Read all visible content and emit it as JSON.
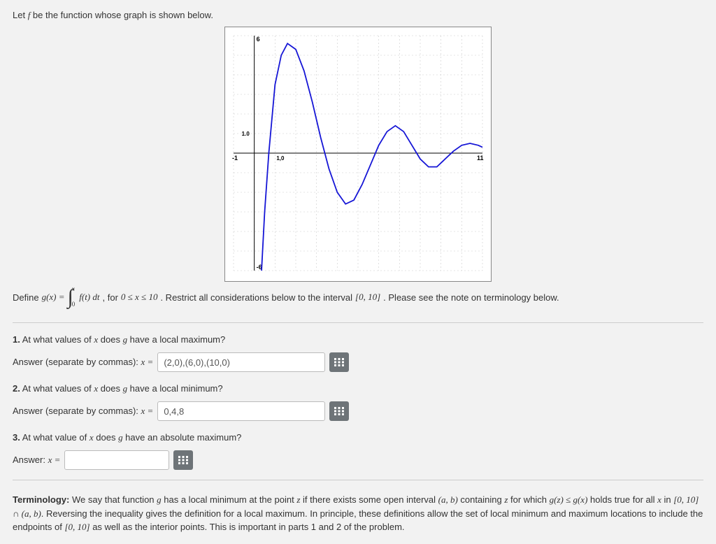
{
  "intro_pre": "Let ",
  "intro_fn": "f",
  "intro_post": " be the function whose graph is shown below.",
  "define": {
    "pre": "Define ",
    "lhs": "g(x) = ",
    "int_lower": "0",
    "int_upper": "x",
    "integrand": "f(t) dt",
    "post1": ", for ",
    "cond": "0 ≤ x ≤ 10",
    "post2": ". Restrict all considerations below to the interval ",
    "interval": "[0, 10]",
    "post3": ". Please see the note on terminology below."
  },
  "q1": {
    "num": "1.",
    "text": " At what values of ",
    "var": "x",
    "text2": " does ",
    "fn": "g",
    "text3": " have a local maximum?",
    "ans_label_pre": "Answer (separate by commas): ",
    "ans_eq": "x = ",
    "value": "(2,0),(6,0),(10,0)"
  },
  "q2": {
    "num": "2.",
    "text": " At what values of ",
    "var": "x",
    "text2": " does ",
    "fn": "g",
    "text3": " have a local minimum?",
    "ans_label_pre": "Answer (separate by commas): ",
    "ans_eq": "x = ",
    "value": "0,4,8"
  },
  "q3": {
    "num": "3.",
    "text": " At what value of ",
    "var": "x",
    "text2": " does ",
    "fn": "g",
    "text3": " have an absolute maximum?",
    "ans_label_pre": "Answer: ",
    "ans_eq": "x = ",
    "value": ""
  },
  "term": {
    "label": "Terminology:",
    "t1": " We say that function ",
    "g": "g",
    "t2": " has a local minimum at the point ",
    "z": "z",
    "t3": " if there exists some open interval ",
    "ab": "(a, b)",
    "t4": " containing ",
    "t5": " for which ",
    "ineq": "g(z) ≤ g(x)",
    "t6": " holds true for all ",
    "x": "x",
    "t7": " in ",
    "int1": "[0, 10] ∩ (a, b)",
    "t8": ". Reversing the inequality gives the definition for a local maximum. In principle, these definitions allow the set of local minimum and maximum locations to include the endpoints of ",
    "int2": "[0, 10]",
    "t9": " as well as the interior points. This is important in parts 1 and 2 of the problem."
  },
  "chart_data": {
    "type": "line",
    "title": "",
    "xlabel": "",
    "ylabel": "",
    "xlim": [
      -1,
      11
    ],
    "ylim": [
      -6,
      6
    ],
    "x_axis_label_point": "1,0",
    "y_axis_label_point": "1.0",
    "curve_points": [
      [
        0.35,
        -6.0
      ],
      [
        0.5,
        -3.0
      ],
      [
        0.7,
        0.0
      ],
      [
        1.0,
        3.5
      ],
      [
        1.3,
        5.0
      ],
      [
        1.6,
        5.6
      ],
      [
        2.0,
        5.3
      ],
      [
        2.4,
        4.2
      ],
      [
        2.8,
        2.6
      ],
      [
        3.2,
        0.8
      ],
      [
        3.6,
        -0.8
      ],
      [
        4.0,
        -2.0
      ],
      [
        4.4,
        -2.6
      ],
      [
        4.8,
        -2.4
      ],
      [
        5.2,
        -1.6
      ],
      [
        5.6,
        -0.6
      ],
      [
        6.0,
        0.4
      ],
      [
        6.4,
        1.1
      ],
      [
        6.8,
        1.4
      ],
      [
        7.2,
        1.1
      ],
      [
        7.6,
        0.4
      ],
      [
        8.0,
        -0.3
      ],
      [
        8.4,
        -0.7
      ],
      [
        8.8,
        -0.7
      ],
      [
        9.2,
        -0.3
      ],
      [
        9.6,
        0.1
      ],
      [
        10.0,
        0.4
      ],
      [
        10.4,
        0.5
      ],
      [
        10.8,
        0.4
      ],
      [
        11.0,
        0.3
      ]
    ],
    "x_ticks": [
      -1,
      11
    ],
    "y_ticks": [
      -6,
      6
    ]
  }
}
